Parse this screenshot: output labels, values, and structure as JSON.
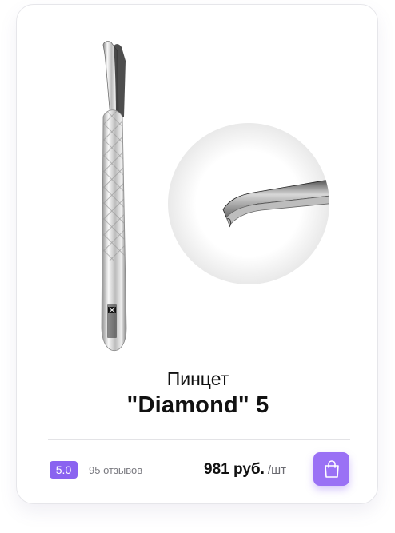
{
  "product": {
    "title_line1": "Пинцет",
    "title_line2": "\"Diamond\" 5",
    "brand_text": "XTREME LOOK"
  },
  "rating": {
    "value": "5.0",
    "reviews": "95 отзывов"
  },
  "price": {
    "amount": "981 руб.",
    "unit": "/шт"
  },
  "icons": {
    "cart": "shopping-bag-icon"
  },
  "colors": {
    "accent": "#8a63f0",
    "button": "#9a71f5",
    "text": "#111111",
    "muted": "#7a7a80"
  }
}
